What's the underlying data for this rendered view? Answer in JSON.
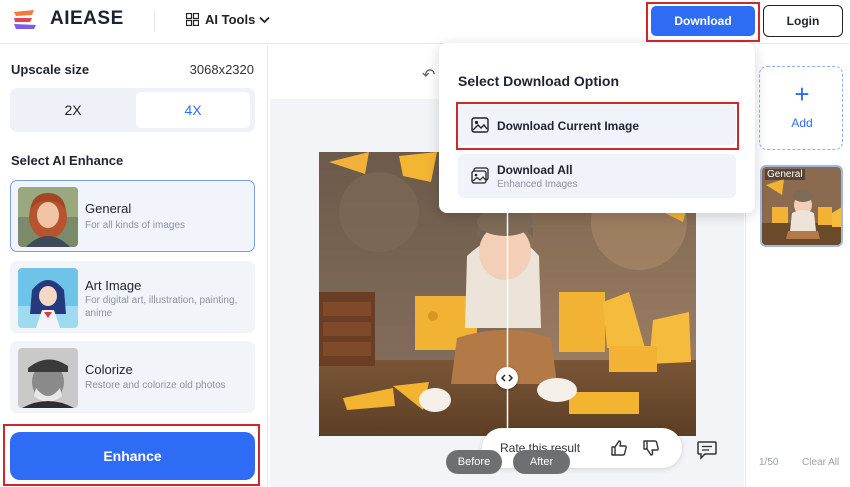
{
  "header": {
    "logo_text": "AIEASE",
    "ai_tools_label": "AI Tools",
    "download_label": "Download",
    "login_label": "Login"
  },
  "left_panel": {
    "upscale_title": "Upscale size",
    "upscale_value": "3068x2320",
    "scale_options": [
      "2X",
      "4X"
    ],
    "selected_scale": "4X",
    "enhance_title": "Select AI Enhance",
    "modes": [
      {
        "title": "General",
        "desc": "For all kinds of images",
        "selected": true
      },
      {
        "title": "Art Image",
        "desc": "For digital art, illustration, painting, anime",
        "selected": false
      },
      {
        "title": "Colorize",
        "desc": "Restore and colorize old photos",
        "selected": false
      }
    ],
    "enhance_button": "Enhance"
  },
  "canvas": {
    "before_label": "Before",
    "after_label": "After",
    "rate_label": "Rate this result"
  },
  "right_panel": {
    "add_label": "Add",
    "thumb_label": "General",
    "pager": "1/50",
    "clear_all": "Clear All"
  },
  "download_menu": {
    "title": "Select Download Option",
    "current_label": "Download Current Image",
    "all_label": "Download All",
    "all_sub": "Enhanced Images"
  },
  "colors": {
    "accent": "#2f6cf6",
    "highlight": "#d3262b"
  }
}
